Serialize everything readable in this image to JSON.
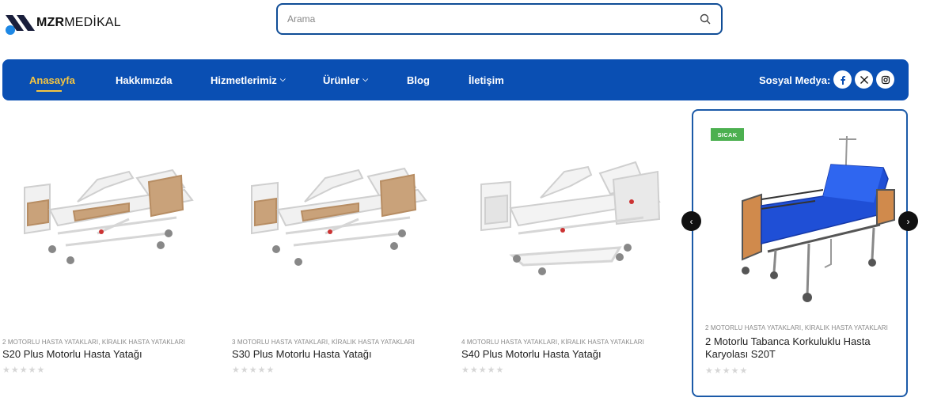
{
  "header": {
    "logo_bold": "MZR",
    "logo_light": "MEDİKAL",
    "search_placeholder": "Arama"
  },
  "nav": {
    "items": [
      {
        "label": "Anasayfa",
        "active": true,
        "dropdown": false
      },
      {
        "label": "Hakkımızda",
        "active": false,
        "dropdown": false
      },
      {
        "label": "Hizmetlerimiz",
        "active": false,
        "dropdown": true
      },
      {
        "label": "Ürünler",
        "active": false,
        "dropdown": true
      },
      {
        "label": "Blog",
        "active": false,
        "dropdown": false
      },
      {
        "label": "İletişim",
        "active": false,
        "dropdown": false
      }
    ],
    "social_label": "Sosyal Medya:",
    "social": [
      "facebook-icon",
      "x-icon",
      "instagram-icon"
    ]
  },
  "products": [
    {
      "category": "2 MOTORLU HASTA YATAKLARI, KİRALIK HASTA YATAKLARI",
      "title": "S20 Plus Motorlu Hasta Yatağı",
      "rating": 0
    },
    {
      "category": "3 MOTORLU HASTA YATAKLARI, KİRALIK HASTA YATAKLARI",
      "title": "S30 Plus Motorlu Hasta Yatağı",
      "rating": 0
    },
    {
      "category": "4 MOTORLU HASTA YATAKLARI, KİRALIK HASTA YATAKLARI",
      "title": "S40 Plus Motorlu Hasta Yatağı",
      "rating": 0
    },
    {
      "category": "2 MOTORLU HASTA YATAKLARI, KİRALIK HASTA YATAKLARI",
      "title": "2 Motorlu Tabanca Korkuluklu Hasta Karyolası S20T",
      "rating": 0,
      "badge": "SICAK"
    }
  ],
  "stars_text": "★★★★★",
  "arrows": {
    "prev": "‹",
    "next": "›"
  },
  "colors": {
    "primary": "#0a4fb3",
    "accent": "#f4c542",
    "badge": "#4cb050",
    "featured_border": "#1b5aa8"
  }
}
